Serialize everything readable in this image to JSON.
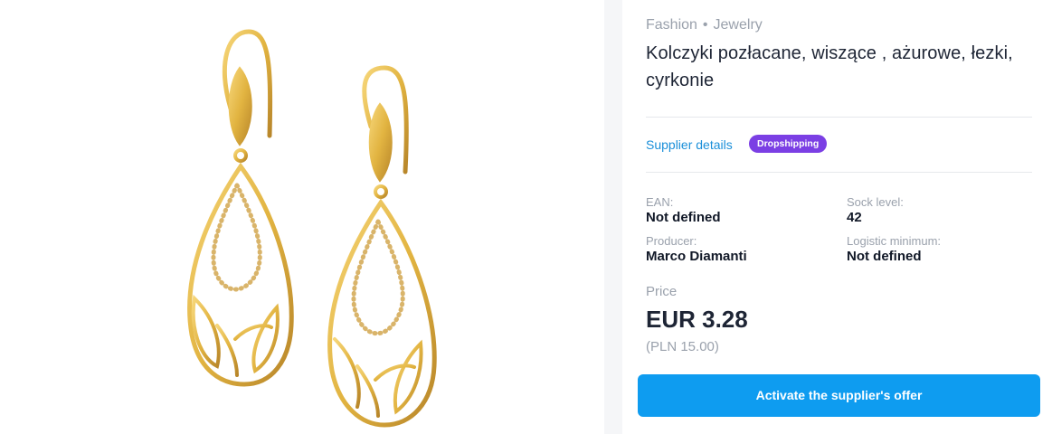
{
  "product": {
    "breadcrumb": [
      "Fashion",
      "Jewelry"
    ],
    "breadcrumb_separator": "•",
    "title": "Kolczyki pozłacane, wiszące , ażurowe, łezki, cyrkonie",
    "supplier_link": "Supplier details",
    "badge": "Dropshipping",
    "image_icon": "gold-drop-earrings"
  },
  "specs": {
    "ean_label": "EAN:",
    "ean_value": "Not defined",
    "stock_label": "Sock level:",
    "stock_value": "42",
    "producer_label": "Producer:",
    "producer_value": "Marco Diamanti",
    "logistic_label": "Logistic minimum:",
    "logistic_value": "Not defined"
  },
  "price": {
    "label": "Price",
    "main": "EUR 3.28",
    "secondary": "(PLN 15.00)"
  },
  "actions": {
    "cta_label": "Activate the supplier's offer"
  },
  "colors": {
    "accent": "#0e9cf0",
    "badge": "#7b3fe4",
    "link": "#1a8fd9",
    "gold": "#e2b441"
  }
}
